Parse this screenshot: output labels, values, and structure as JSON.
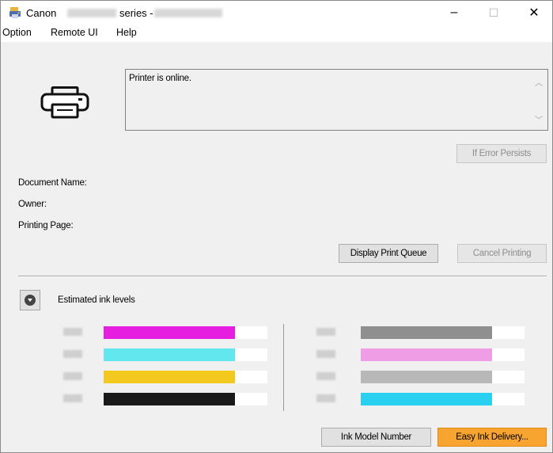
{
  "window": {
    "title_prefix": "Canon",
    "title_series": "series -",
    "min_glyph": "–",
    "max_glyph": "☐",
    "close_glyph": "✕"
  },
  "menu": [
    "Option",
    "Remote UI",
    "Help"
  ],
  "status": {
    "text": "Printer is online."
  },
  "buttons": {
    "if_error_persists": "If Error Persists",
    "display_print_queue": "Display Print Queue",
    "cancel_printing": "Cancel Printing",
    "ink_model_number": "Ink Model Number",
    "easy_ink_delivery": "Easy Ink Delivery..."
  },
  "labels": {
    "document_name": "Document Name:",
    "owner": "Owner:",
    "printing_page": "Printing Page:"
  },
  "ink_section": {
    "title": "Estimated ink levels",
    "left": [
      {
        "color": "#e51ee0",
        "level": 0.8
      },
      {
        "color": "#63e7ee",
        "level": 0.8
      },
      {
        "color": "#f3c91f",
        "level": 0.8
      },
      {
        "color": "#1a1a1a",
        "level": 0.8
      }
    ],
    "right": [
      {
        "color": "#8f8f8f",
        "level": 0.8
      },
      {
        "color": "#ef9ee6",
        "level": 0.8
      },
      {
        "color": "#b8b8b8",
        "level": 0.8
      },
      {
        "color": "#2ad0ef",
        "level": 0.8
      }
    ]
  }
}
